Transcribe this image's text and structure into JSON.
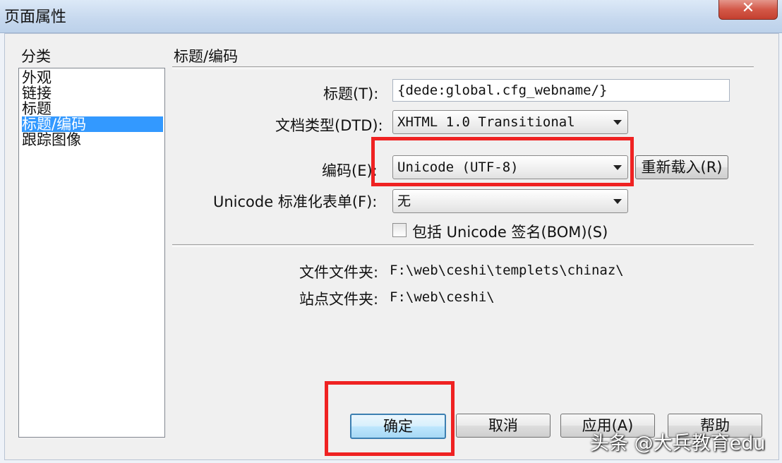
{
  "window": {
    "title": "页面属性",
    "close_glyph": "✕"
  },
  "category": {
    "header": "分类",
    "items": [
      {
        "label": "外观"
      },
      {
        "label": "链接"
      },
      {
        "label": "标题"
      },
      {
        "label": "标题/编码"
      },
      {
        "label": "跟踪图像"
      }
    ],
    "selected": "标题/编码"
  },
  "section": {
    "heading": "标题/编码"
  },
  "form": {
    "title_label": "标题(T):",
    "title_value": "{dede:global.cfg_webname/}",
    "doctype_label": "文档类型(DTD):",
    "doctype_value": "XHTML 1.0 Transitional",
    "encoding_label": "编码(E):",
    "encoding_value": "Unicode (UTF-8)",
    "reload_button": "重新载入(R)",
    "normalize_label": "Unicode 标准化表单(F):",
    "normalize_value": "无",
    "bom_checkbox_label": "包括 Unicode 签名(BOM)(S)",
    "bom_checked": false
  },
  "info": {
    "doc_folder_label": "文件文件夹:",
    "doc_folder_value": "F:\\web\\ceshi\\templets\\chinaz\\",
    "site_folder_label": "站点文件夹:",
    "site_folder_value": "F:\\web\\ceshi\\"
  },
  "buttons": {
    "ok": "确定",
    "cancel": "取消",
    "apply": "应用(A)",
    "help": "帮助"
  },
  "watermark": "头条 @大兵教育edu",
  "colors": {
    "highlight": "#ef2222",
    "selection": "#3399ff"
  }
}
